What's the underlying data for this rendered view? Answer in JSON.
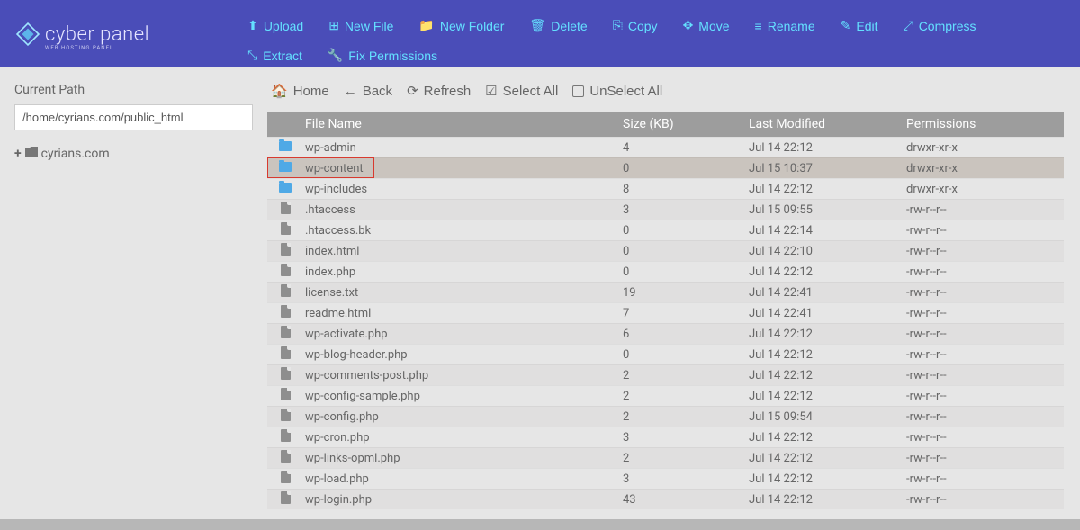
{
  "brand": {
    "name": "cyber panel",
    "sub": "WEB HOSTING PANEL"
  },
  "toolbar": [
    {
      "id": "upload",
      "label": "Upload",
      "icon": "upload"
    },
    {
      "id": "new-file",
      "label": "New File",
      "icon": "plus-square"
    },
    {
      "id": "new-folder",
      "label": "New Folder",
      "icon": "folder"
    },
    {
      "id": "delete",
      "label": "Delete",
      "icon": "trash"
    },
    {
      "id": "copy",
      "label": "Copy",
      "icon": "copy"
    },
    {
      "id": "move",
      "label": "Move",
      "icon": "move"
    },
    {
      "id": "rename",
      "label": "Rename",
      "icon": "rename"
    },
    {
      "id": "edit",
      "label": "Edit",
      "icon": "edit"
    },
    {
      "id": "compress",
      "label": "Compress",
      "icon": "compress"
    },
    {
      "id": "extract",
      "label": "Extract",
      "icon": "extract"
    },
    {
      "id": "fix-permissions",
      "label": "Fix Permissions",
      "icon": "wrench"
    }
  ],
  "sidebar": {
    "path_label": "Current Path",
    "path_value": "/home/cyrians.com/public_html",
    "tree_root": "cyrians.com"
  },
  "nav": {
    "home": "Home",
    "back": "Back",
    "refresh": "Refresh",
    "select_all": "Select All",
    "unselect_all": "UnSelect All"
  },
  "table": {
    "headers": {
      "name": "File Name",
      "size": "Size (KB)",
      "modified": "Last Modified",
      "perms": "Permissions"
    },
    "rows": [
      {
        "type": "folder",
        "name": "wp-admin",
        "size": "4",
        "modified": "Jul 14 22:12",
        "perms": "drwxr-xr-x",
        "selected": false
      },
      {
        "type": "folder",
        "name": "wp-content",
        "size": "0",
        "modified": "Jul 15 10:37",
        "perms": "drwxr-xr-x",
        "selected": true,
        "highlight": true
      },
      {
        "type": "folder",
        "name": "wp-includes",
        "size": "8",
        "modified": "Jul 14 22:12",
        "perms": "drwxr-xr-x",
        "selected": false
      },
      {
        "type": "file",
        "name": ".htaccess",
        "size": "3",
        "modified": "Jul 15 09:55",
        "perms": "-rw-r--r--",
        "selected": false
      },
      {
        "type": "file",
        "name": ".htaccess.bk",
        "size": "0",
        "modified": "Jul 14 22:14",
        "perms": "-rw-r--r--",
        "selected": false
      },
      {
        "type": "file",
        "name": "index.html",
        "size": "0",
        "modified": "Jul 14 22:10",
        "perms": "-rw-r--r--",
        "selected": false
      },
      {
        "type": "file",
        "name": "index.php",
        "size": "0",
        "modified": "Jul 14 22:12",
        "perms": "-rw-r--r--",
        "selected": false
      },
      {
        "type": "file",
        "name": "license.txt",
        "size": "19",
        "modified": "Jul 14 22:41",
        "perms": "-rw-r--r--",
        "selected": false
      },
      {
        "type": "file",
        "name": "readme.html",
        "size": "7",
        "modified": "Jul 14 22:41",
        "perms": "-rw-r--r--",
        "selected": false
      },
      {
        "type": "file",
        "name": "wp-activate.php",
        "size": "6",
        "modified": "Jul 14 22:12",
        "perms": "-rw-r--r--",
        "selected": false
      },
      {
        "type": "file",
        "name": "wp-blog-header.php",
        "size": "0",
        "modified": "Jul 14 22:12",
        "perms": "-rw-r--r--",
        "selected": false
      },
      {
        "type": "file",
        "name": "wp-comments-post.php",
        "size": "2",
        "modified": "Jul 14 22:12",
        "perms": "-rw-r--r--",
        "selected": false
      },
      {
        "type": "file",
        "name": "wp-config-sample.php",
        "size": "2",
        "modified": "Jul 14 22:12",
        "perms": "-rw-r--r--",
        "selected": false
      },
      {
        "type": "file",
        "name": "wp-config.php",
        "size": "2",
        "modified": "Jul 15 09:54",
        "perms": "-rw-r--r--",
        "selected": false
      },
      {
        "type": "file",
        "name": "wp-cron.php",
        "size": "3",
        "modified": "Jul 14 22:12",
        "perms": "-rw-r--r--",
        "selected": false
      },
      {
        "type": "file",
        "name": "wp-links-opml.php",
        "size": "2",
        "modified": "Jul 14 22:12",
        "perms": "-rw-r--r--",
        "selected": false
      },
      {
        "type": "file",
        "name": "wp-load.php",
        "size": "3",
        "modified": "Jul 14 22:12",
        "perms": "-rw-r--r--",
        "selected": false
      },
      {
        "type": "file",
        "name": "wp-login.php",
        "size": "43",
        "modified": "Jul 14 22:12",
        "perms": "-rw-r--r--",
        "selected": false
      }
    ]
  }
}
